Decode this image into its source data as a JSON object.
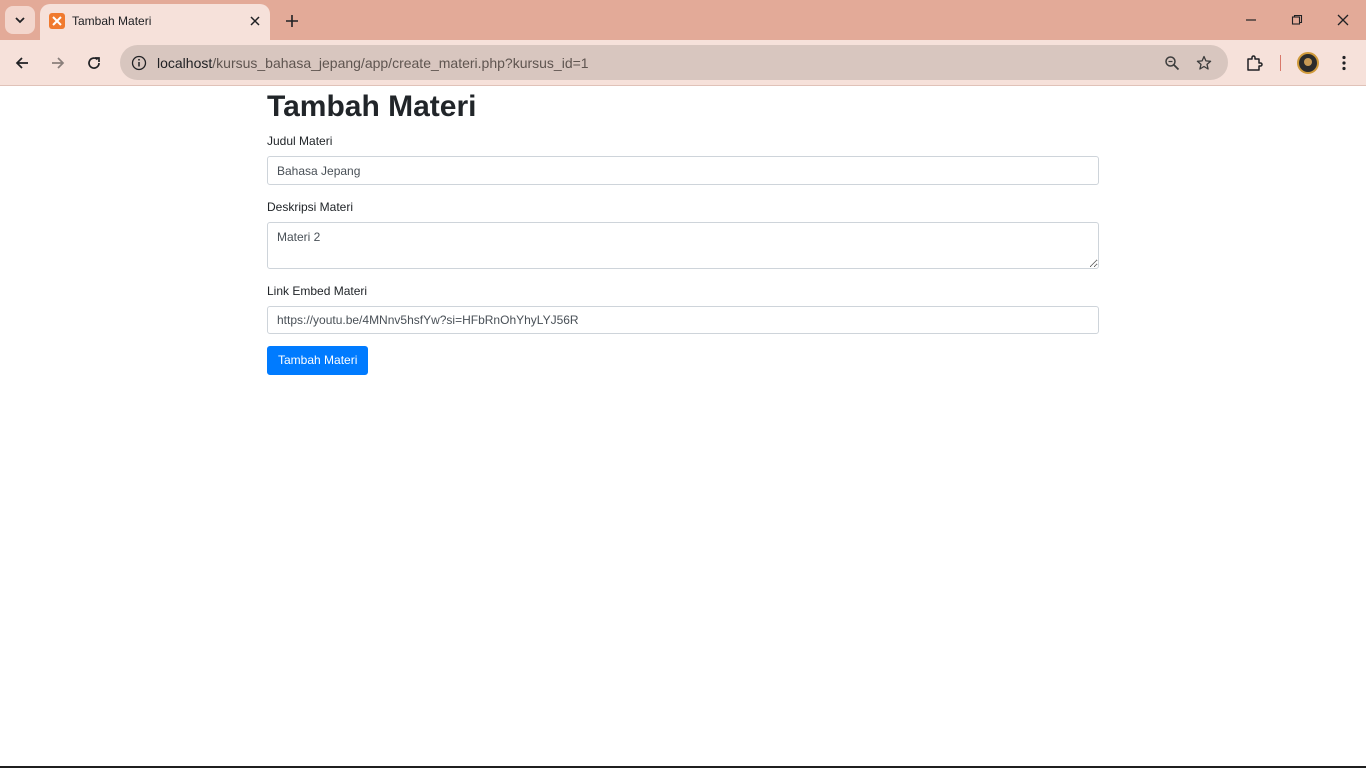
{
  "browser": {
    "tab_title": "Tambah Materi",
    "url_host": "localhost",
    "url_path": "/kursus_bahasa_jepang/app/create_materi.php?kursus_id=1"
  },
  "page": {
    "title": "Tambah Materi",
    "judul": {
      "label": "Judul Materi",
      "value": "Bahasa Jepang"
    },
    "deskripsi": {
      "label": "Deskripsi Materi",
      "value": "Materi 2"
    },
    "link": {
      "label": "Link Embed Materi",
      "value": "https://youtu.be/4MNnv5hsfYw?si=HFbRnOhYhyLYJ56R"
    },
    "submit_label": "Tambah Materi"
  },
  "colors": {
    "tabbar": "#e3aa98",
    "toolbar": "#f6e1da",
    "primary_button": "#007bff"
  }
}
